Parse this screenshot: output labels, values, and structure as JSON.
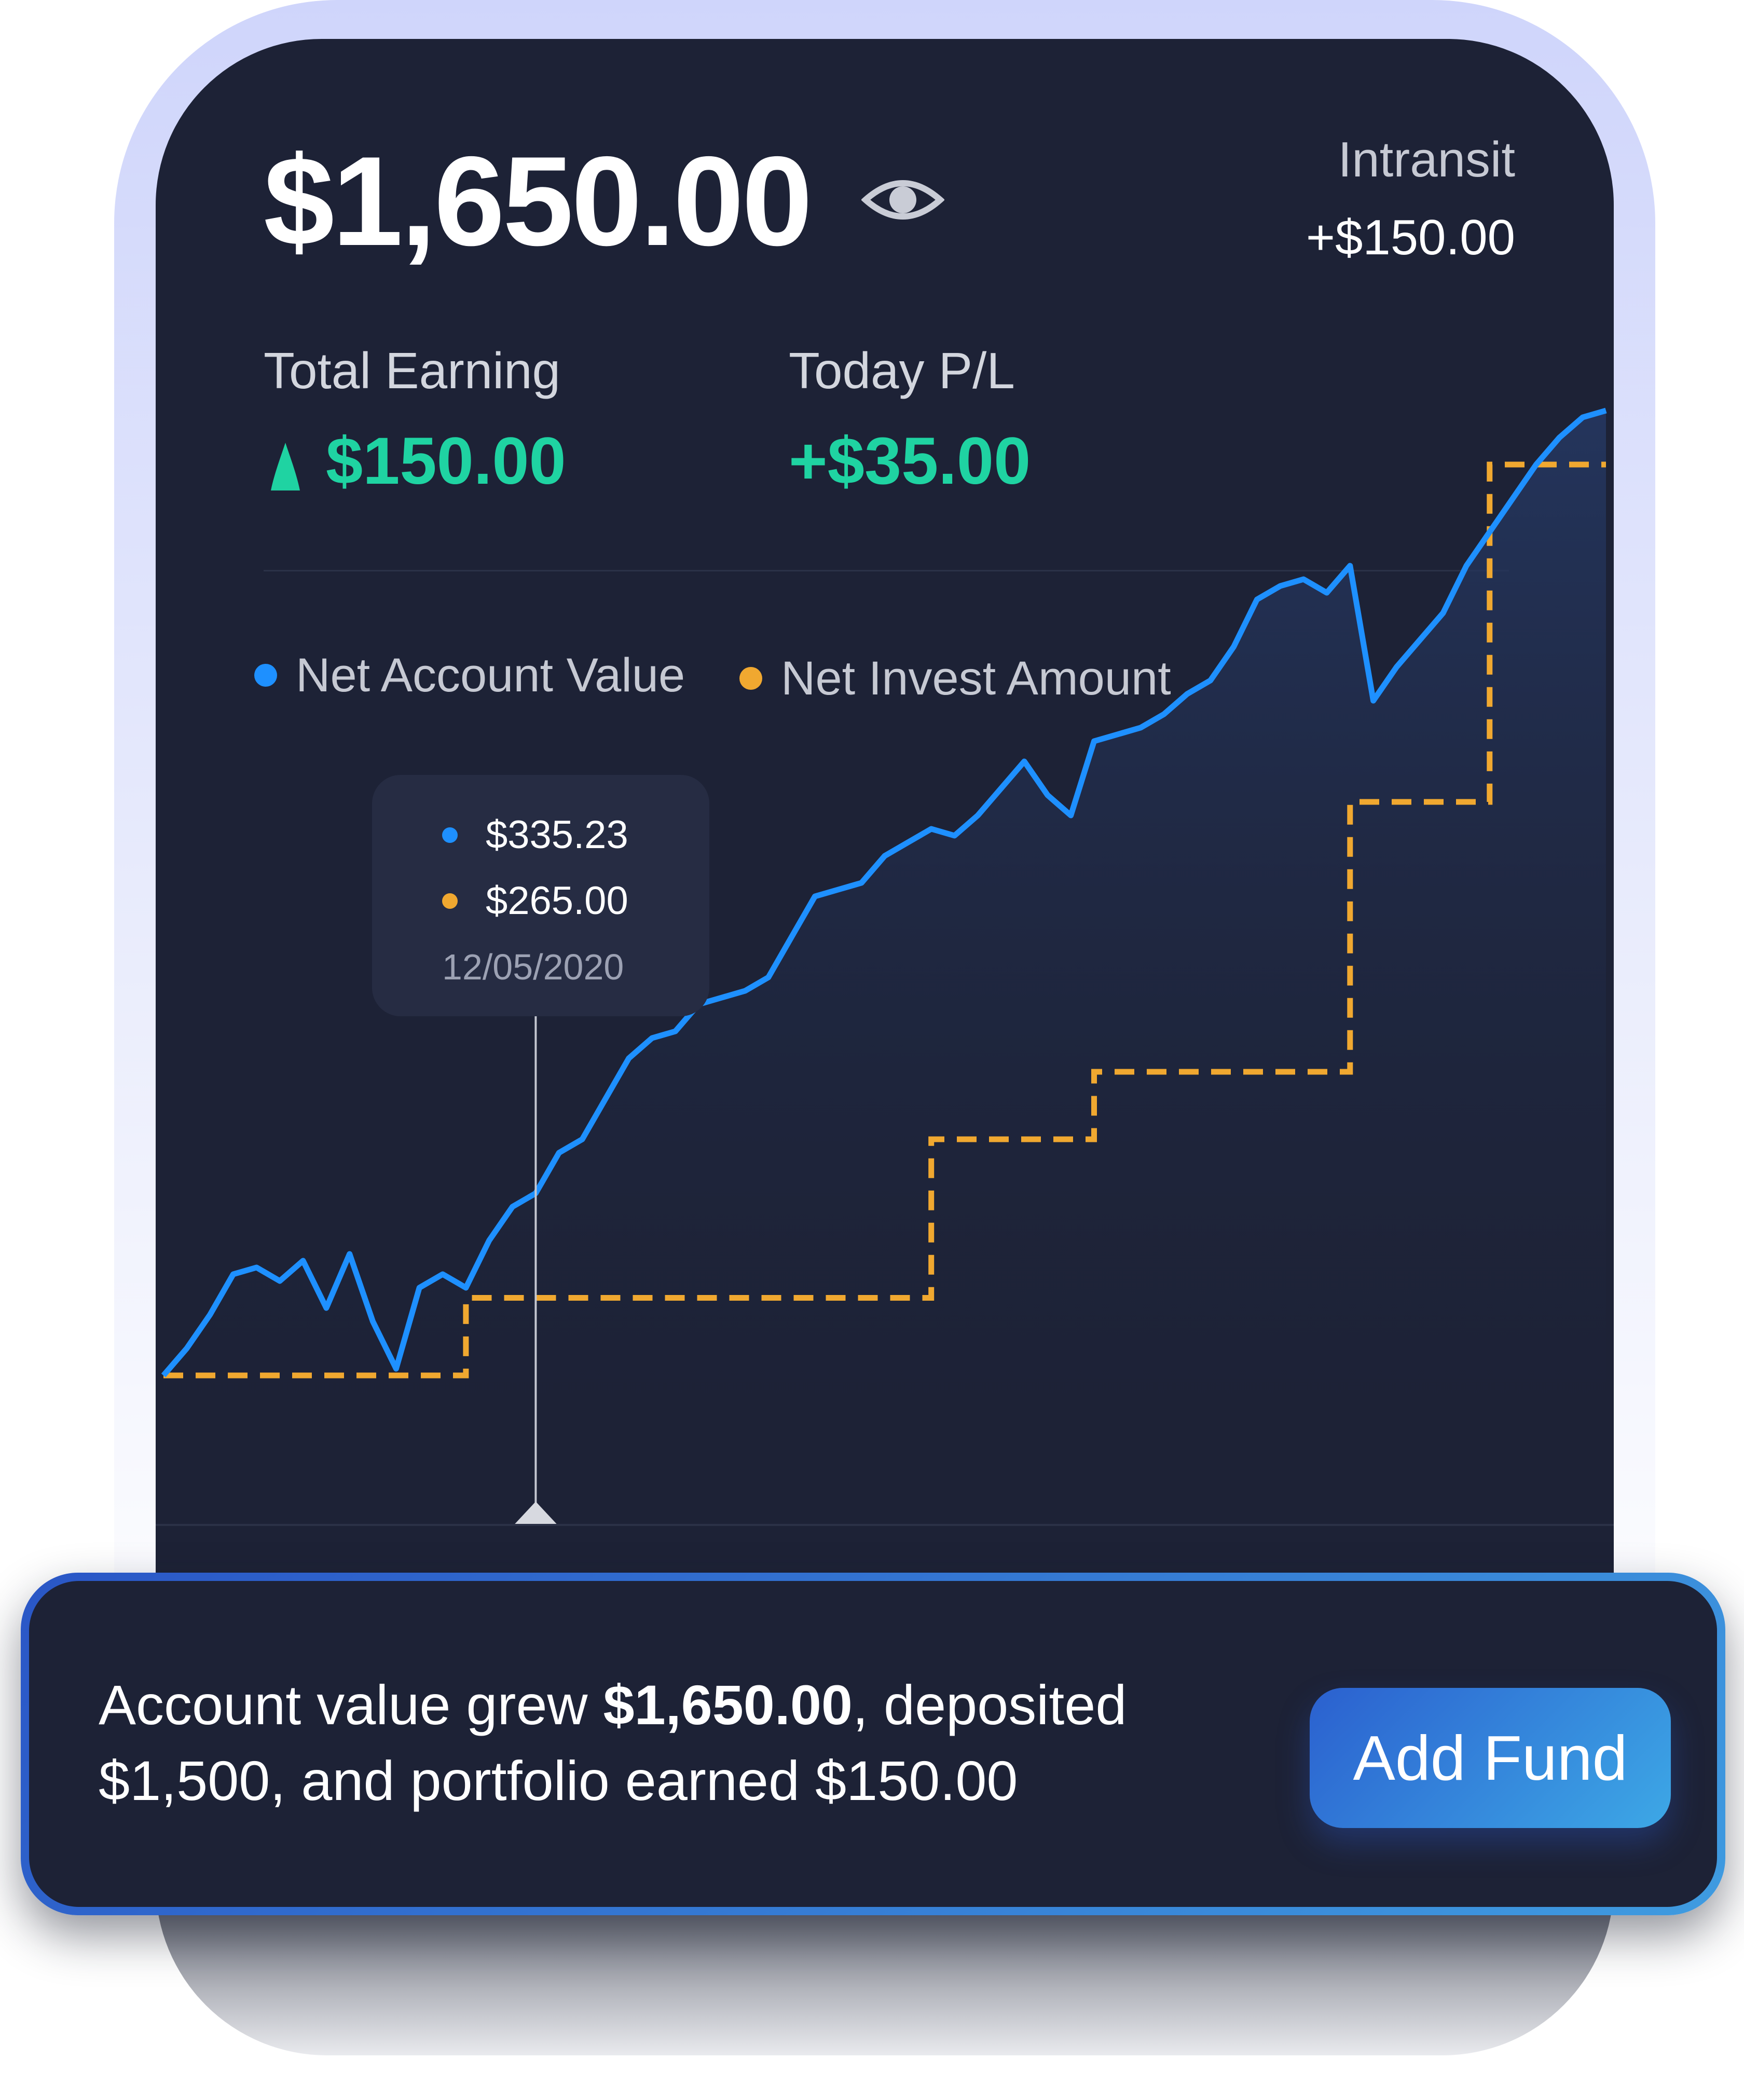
{
  "balance": "$1,650.00",
  "intransit": {
    "label": "Intransit",
    "value": "+$150.00"
  },
  "stats": {
    "total_earning": {
      "label": "Total Earning",
      "value": "$150.00"
    },
    "today_pl": {
      "label": "Today P/L",
      "value": "+$35.00"
    }
  },
  "legend": {
    "net_account": "Net Account Value",
    "net_invest": "Net Invest Amount"
  },
  "tooltip": {
    "account_value": "$335.23",
    "invest_value": "$265.00",
    "date": "12/05/2020"
  },
  "summary": {
    "part1": "Account value grew ",
    "bold": "$1,650.00",
    "part2": ", deposited $1,500, and portfolio earned $150.00"
  },
  "add_fund_label": "Add Fund",
  "colors": {
    "background_card": "#1d2236",
    "account_line": "#1e90ff",
    "invest_line": "#f0a830",
    "positive": "#1fd3a2",
    "button_gradient": [
      "#2b60cf",
      "#3da8e6"
    ]
  },
  "icons": {
    "visibility": "eye-icon",
    "trend": "up-arrow-icon"
  },
  "chart_data": {
    "type": "line",
    "series": [
      {
        "name": "Net Account Value",
        "values": [
          150,
          190,
          240,
          300,
          310,
          290,
          320,
          250,
          330,
          230,
          160,
          280,
          300,
          280,
          350,
          400,
          420,
          480,
          500,
          560,
          620,
          650,
          660,
          700,
          710,
          720,
          740,
          800,
          860,
          870,
          880,
          920,
          940,
          960,
          950,
          980,
          1020,
          1060,
          1010,
          980,
          1090,
          1100,
          1110,
          1130,
          1160,
          1180,
          1230,
          1300,
          1320,
          1330,
          1310,
          1350,
          1150,
          1200,
          1240,
          1280,
          1350,
          1400,
          1450,
          1500,
          1540,
          1570,
          1580
        ]
      },
      {
        "name": "Net Invest Amount",
        "values": [
          150,
          150,
          150,
          150,
          150,
          150,
          150,
          150,
          150,
          150,
          150,
          150,
          150,
          265,
          265,
          265,
          265,
          265,
          265,
          265,
          265,
          265,
          265,
          265,
          265,
          265,
          265,
          265,
          265,
          265,
          265,
          265,
          265,
          500,
          500,
          500,
          500,
          500,
          500,
          500,
          600,
          600,
          600,
          600,
          600,
          600,
          600,
          600,
          600,
          600,
          600,
          1000,
          1000,
          1000,
          1000,
          1000,
          1000,
          1500,
          1500,
          1500,
          1500,
          1500,
          1500
        ]
      }
    ],
    "tooltip_index": 16
  }
}
